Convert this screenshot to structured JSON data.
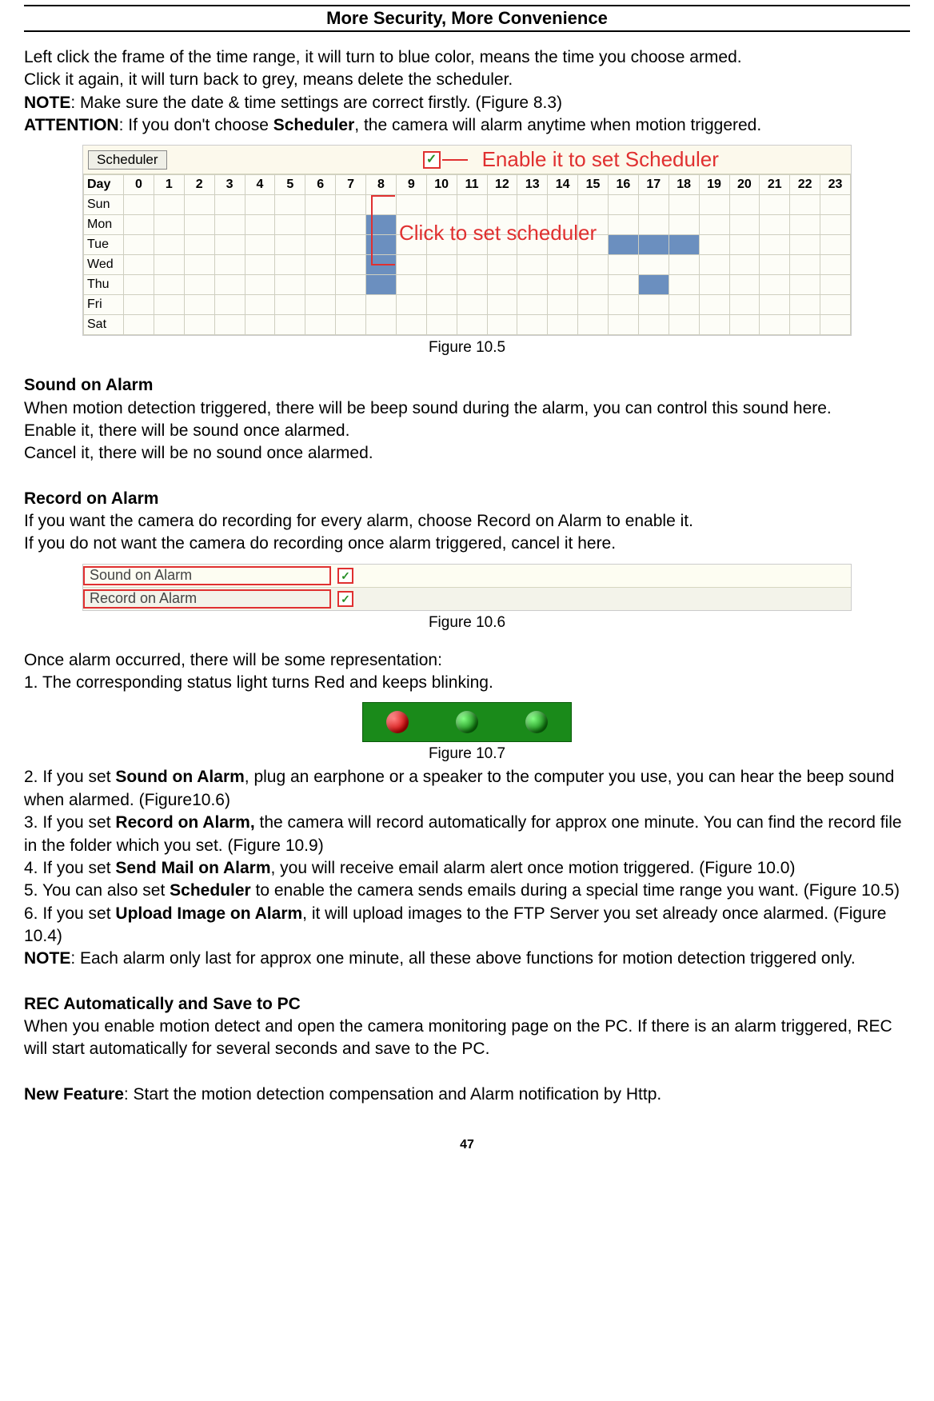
{
  "header_title": "More Security, More Convenience",
  "intro": {
    "line1": "Left click the frame of the time range, it will turn to blue color, means the time you choose armed.",
    "line2": "Click it again, it will turn back to grey, means delete the scheduler.",
    "note_label": "NOTE",
    "note_text": ": Make sure the date & time settings are correct firstly. (Figure 8.3)",
    "attention_label": "ATTENTION",
    "attention_mid": ": If you don't choose ",
    "attention_bold": "Scheduler",
    "attention_end": ", the camera will alarm anytime when motion triggered."
  },
  "fig105": {
    "scheduler_btn": "Scheduler",
    "enable_label": "Enable it to set Scheduler",
    "click_label": "Click to set scheduler",
    "caption": "Figure 10.5",
    "day_header": "Day",
    "hours": [
      "0",
      "1",
      "2",
      "3",
      "4",
      "5",
      "6",
      "7",
      "8",
      "9",
      "10",
      "11",
      "12",
      "13",
      "14",
      "15",
      "16",
      "17",
      "18",
      "19",
      "20",
      "21",
      "22",
      "23"
    ],
    "days": [
      "Sun",
      "Mon",
      "Tue",
      "Wed",
      "Thu",
      "Fri",
      "Sat"
    ],
    "armed": {
      "Sun": [],
      "Mon": [
        8
      ],
      "Tue": [
        8,
        16,
        17,
        18
      ],
      "Wed": [
        8
      ],
      "Thu": [
        8,
        17
      ],
      "Fri": [],
      "Sat": []
    }
  },
  "sound_on_alarm": {
    "heading": "Sound on Alarm",
    "p1": "When motion detection triggered, there will be beep sound during the alarm, you can control this sound here.",
    "p2": "Enable it, there will be sound once alarmed.",
    "p3": "Cancel it, there will be no sound once alarmed."
  },
  "record_on_alarm": {
    "heading": "Record on Alarm",
    "p1": "If you want the camera do recording for every alarm, choose Record on Alarm to enable it.",
    "p2": "If you do not want the camera do recording once alarm triggered, cancel it here."
  },
  "fig106": {
    "row1": "Sound on Alarm",
    "row2": "Record on Alarm",
    "caption": "Figure 10.6"
  },
  "after_fig106": {
    "line1": "Once alarm occurred, there will be some representation:",
    "line2": "1. The corresponding status light turns Red and keeps blinking."
  },
  "fig107": {
    "caption": "Figure 10.7"
  },
  "list": {
    "item2_pre": "2. If you set ",
    "item2_bold": "Sound on Alarm",
    "item2_post": ", plug an earphone or a speaker to the computer you use, you can hear the beep sound when alarmed. (Figure10.6)",
    "item3_pre": "3. If you set ",
    "item3_bold": "Record on Alarm,",
    "item3_post": " the camera will record automatically for approx one minute. You can find the record file in the folder which you set. (Figure 10.9)",
    "item4_pre": "4. If you set ",
    "item4_bold": "Send Mail on Alarm",
    "item4_post": ", you will receive email alarm alert once motion triggered. (Figure 10.0)",
    "item5_pre": "5. You can also set ",
    "item5_bold": "Scheduler",
    "item5_post": " to enable the camera sends emails during a special time range you want. (Figure 10.5)",
    "item6_pre": "6. If you set ",
    "item6_bold": "Upload Image on Alarm",
    "item6_post": ", it will upload images to the FTP Server you set already once alarmed. (Figure 10.4)",
    "note_label": "NOTE",
    "note_text": ": Each alarm only last for approx one minute, all these above functions for motion detection triggered only."
  },
  "rec_section": {
    "heading": "REC Automatically and Save to PC",
    "p1": "When you enable motion detect and open the camera monitoring page on the PC. If there is an alarm triggered, REC will start automatically for several seconds and save to the PC."
  },
  "new_feature": {
    "label": "New Feature",
    "text": ": Start the motion detection compensation and Alarm notification by Http."
  },
  "page_number": "47"
}
